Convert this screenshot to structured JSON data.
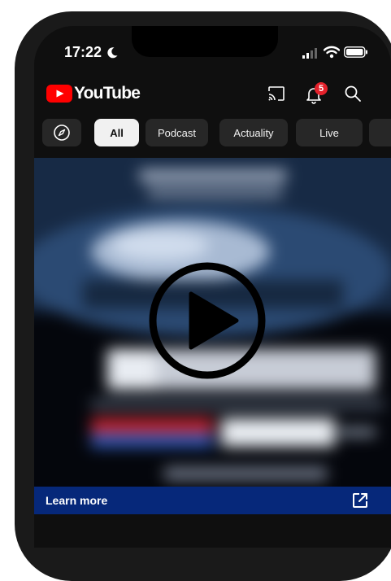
{
  "status_bar": {
    "time": "17:22",
    "icons": [
      "moon-icon",
      "signal-icon",
      "wifi-icon",
      "battery-icon"
    ]
  },
  "header": {
    "logo_text": "YouTube",
    "notification_count": "5",
    "icons": [
      "youtube-logo-icon",
      "cast-icon",
      "bell-icon",
      "search-icon"
    ]
  },
  "chips": [
    {
      "label": "All",
      "selected": true
    },
    {
      "label": "Podcast",
      "selected": false
    },
    {
      "label": "Actuality",
      "selected": false
    },
    {
      "label": "Live",
      "selected": false
    },
    {
      "label": "",
      "selected": false
    }
  ],
  "video": {
    "state": "paused",
    "icons": [
      "play-icon"
    ]
  },
  "ad": {
    "cta_label": "Learn more",
    "icons": [
      "external-link-icon"
    ]
  },
  "colors": {
    "background": "#0f0f0f",
    "brand_red": "#ff0000",
    "badge_red": "#e4212b",
    "chip_selected": "#f1f1f1",
    "chip_default": "#272727",
    "cta_bar": "#06287a"
  }
}
